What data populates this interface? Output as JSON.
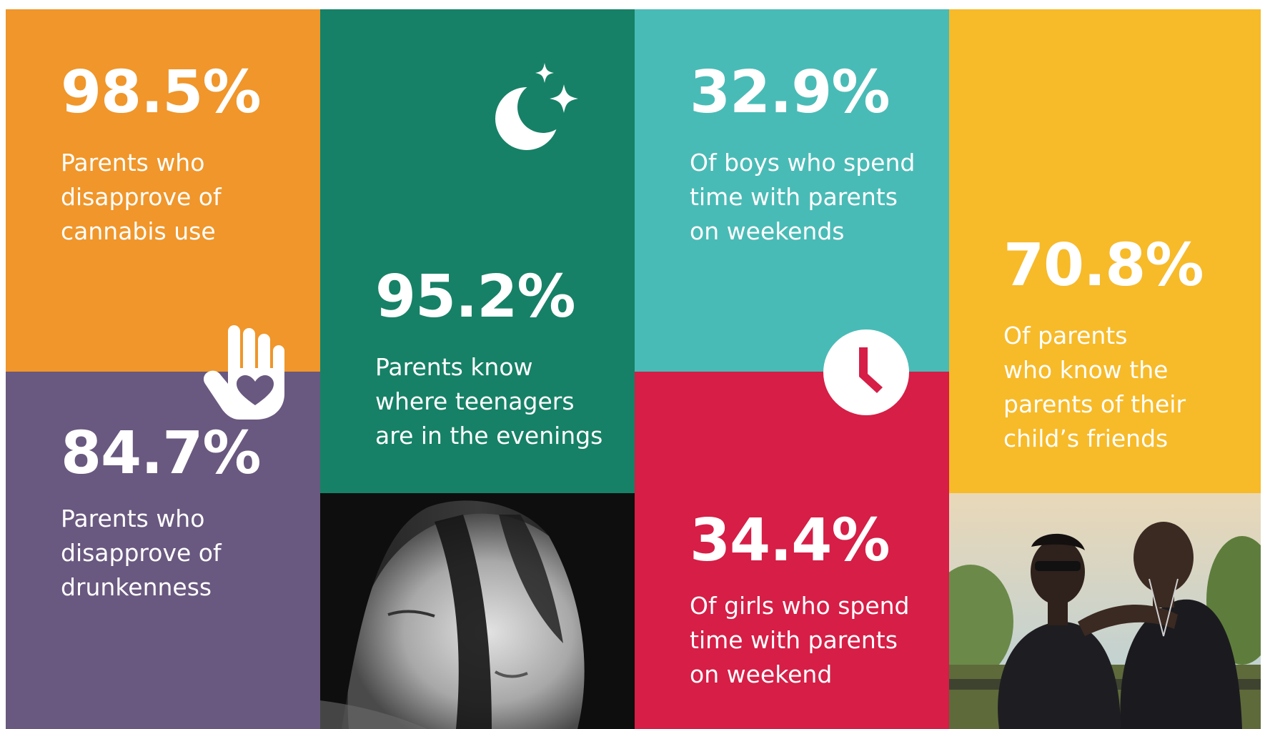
{
  "colors": {
    "orange": "#f0962a",
    "purple": "#69587f",
    "green": "#168166",
    "teal": "#49bbb6",
    "red": "#d61e46",
    "yellow": "#f7ba29"
  },
  "icons": [
    "hand-heart-icon",
    "moon-stars-icon",
    "clock-icon"
  ],
  "tiles": {
    "cannabis": {
      "stat": "98.5%",
      "lines": [
        "Parents who",
        "disapprove of",
        "cannabis use"
      ]
    },
    "drunkenness": {
      "stat": "84.7%",
      "lines": [
        "Parents who",
        "disapprove of",
        "drunkenness"
      ]
    },
    "evenings": {
      "stat": "95.2%",
      "lines": [
        "Parents know",
        "where teenagers",
        "are in the evenings"
      ]
    },
    "boys": {
      "stat": "32.9%",
      "lines": [
        "Of boys who spend",
        "time with parents",
        "on weekends"
      ]
    },
    "girls": {
      "stat": "34.4%",
      "lines": [
        "Of girls who spend",
        "time with parents",
        "on weekend"
      ]
    },
    "friends": {
      "stat": "70.8%",
      "lines": [
        "Of parents",
        "who know the",
        "parents of their",
        "child’s friends"
      ]
    }
  }
}
